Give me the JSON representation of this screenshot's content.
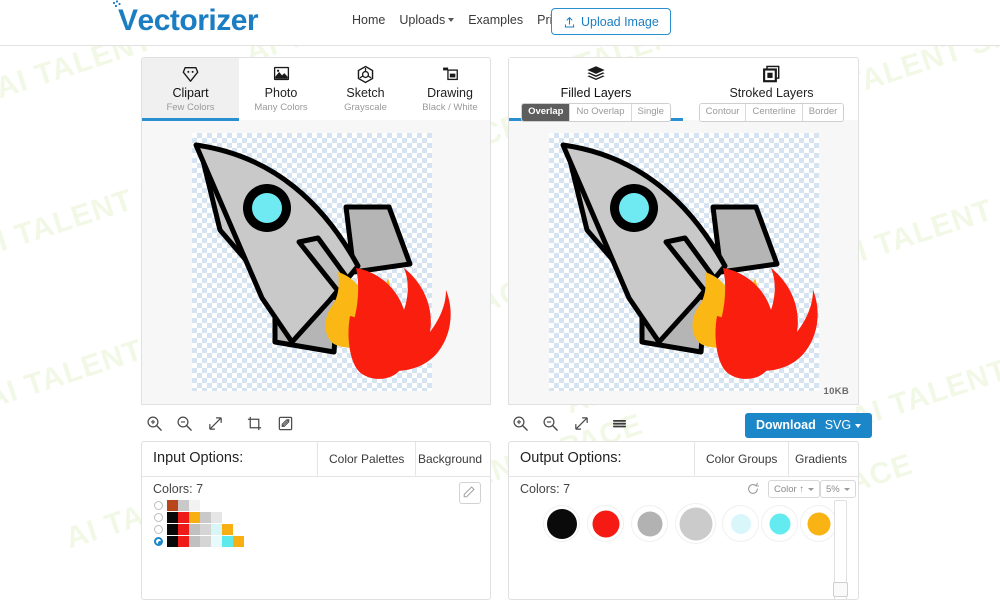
{
  "header": {
    "logo_text": "ectorizer",
    "logo_v": "V",
    "nav": [
      {
        "label": "Home",
        "caret": false
      },
      {
        "label": "Uploads",
        "caret": true
      },
      {
        "label": "Examples",
        "caret": false
      },
      {
        "label": "Pricing",
        "caret": false
      }
    ],
    "upload_button": "Upload Image",
    "upload_icon": "upload-arrow-icon"
  },
  "left_panel": {
    "tabs": [
      {
        "label": "Clipart",
        "sub": "Few Colors",
        "icon": "diamond-gem-icon",
        "active": true
      },
      {
        "label": "Photo",
        "sub": "Many Colors",
        "icon": "picture-image-icon",
        "active": false
      },
      {
        "label": "Sketch",
        "sub": "Grayscale",
        "icon": "hexagon-sketch-icon",
        "active": false
      },
      {
        "label": "Drawing",
        "sub": "Black / White",
        "icon": "drawing-frame-icon",
        "active": false
      }
    ],
    "toolbar": [
      {
        "name": "zoom-in-icon",
        "label": "Zoom In"
      },
      {
        "name": "zoom-out-icon",
        "label": "Zoom Out"
      },
      {
        "name": "fit-expand-icon",
        "label": "Fit"
      },
      {
        "name": "crop-icon",
        "label": "Crop"
      },
      {
        "name": "edit-pencil-icon",
        "label": "Edit"
      }
    ],
    "options": {
      "title": "Input Options:",
      "tabs": [
        {
          "label": "Color Palettes",
          "active": true
        },
        {
          "label": "Background",
          "active": false
        }
      ],
      "colors_label": "Colors: 7",
      "edit_icon": "pencil-edit-icon",
      "palettes": [
        {
          "selected": false,
          "swatches": [
            "#b8461a",
            "#c9c9c9",
            "#f2f2f2"
          ]
        },
        {
          "selected": false,
          "swatches": [
            "#080808",
            "#ef1b18",
            "#f9ae12",
            "#c9c9c9",
            "#e6e6e6"
          ]
        },
        {
          "selected": false,
          "swatches": [
            "#080808",
            "#ef1b18",
            "#c0c0c0",
            "#d5d5d5",
            "#d6f6f8",
            "#f9ae12"
          ]
        },
        {
          "selected": true,
          "swatches": [
            "#080808",
            "#ef1b18",
            "#c0c0c0",
            "#d5d5d5",
            "#e8fbfc",
            "#5ee9ec",
            "#f9ae12"
          ]
        }
      ]
    }
  },
  "right_panel": {
    "tabs": [
      {
        "label": "Filled Layers",
        "icon": "layers-stack-icon",
        "active": true,
        "segments": [
          {
            "label": "Overlap",
            "on": true
          },
          {
            "label": "No Overlap",
            "on": false
          },
          {
            "label": "Single",
            "on": false
          }
        ]
      },
      {
        "label": "Stroked Layers",
        "icon": "stroked-square-icon",
        "active": false,
        "segments": [
          {
            "label": "Contour",
            "on": false
          },
          {
            "label": "Centerline",
            "on": false
          },
          {
            "label": "Border",
            "on": false
          }
        ]
      }
    ],
    "size_badge": "10KB",
    "toolbar": [
      {
        "name": "zoom-in-icon",
        "label": "Zoom In"
      },
      {
        "name": "zoom-out-icon",
        "label": "Zoom Out"
      },
      {
        "name": "fit-expand-icon",
        "label": "Fit"
      },
      {
        "name": "menu-lines-icon",
        "label": "Options"
      }
    ],
    "download": {
      "label": "Download",
      "format": "SVG"
    },
    "options": {
      "title": "Output Options:",
      "tabs": [
        {
          "label": "Color Groups",
          "active": true
        },
        {
          "label": "Gradients",
          "active": false
        }
      ],
      "colors_label": "Colors: 7",
      "reset_icon": "reset-refresh-icon",
      "sort_label": "Color ↑",
      "tolerance_label": "5%",
      "swatches": [
        {
          "color": "#0a0a0a",
          "size": 30
        },
        {
          "color": "#f51a13",
          "size": 27
        },
        {
          "color": "#b2b2b2",
          "size": 25
        },
        {
          "color": "#cbcbcb",
          "size": 32
        },
        {
          "color": "#d9f7fb",
          "size": 20
        },
        {
          "color": "#63ebef",
          "size": 21
        },
        {
          "color": "#f9b312",
          "size": 23
        }
      ]
    }
  },
  "watermark": {
    "text": "AI TALENT SPACE"
  }
}
